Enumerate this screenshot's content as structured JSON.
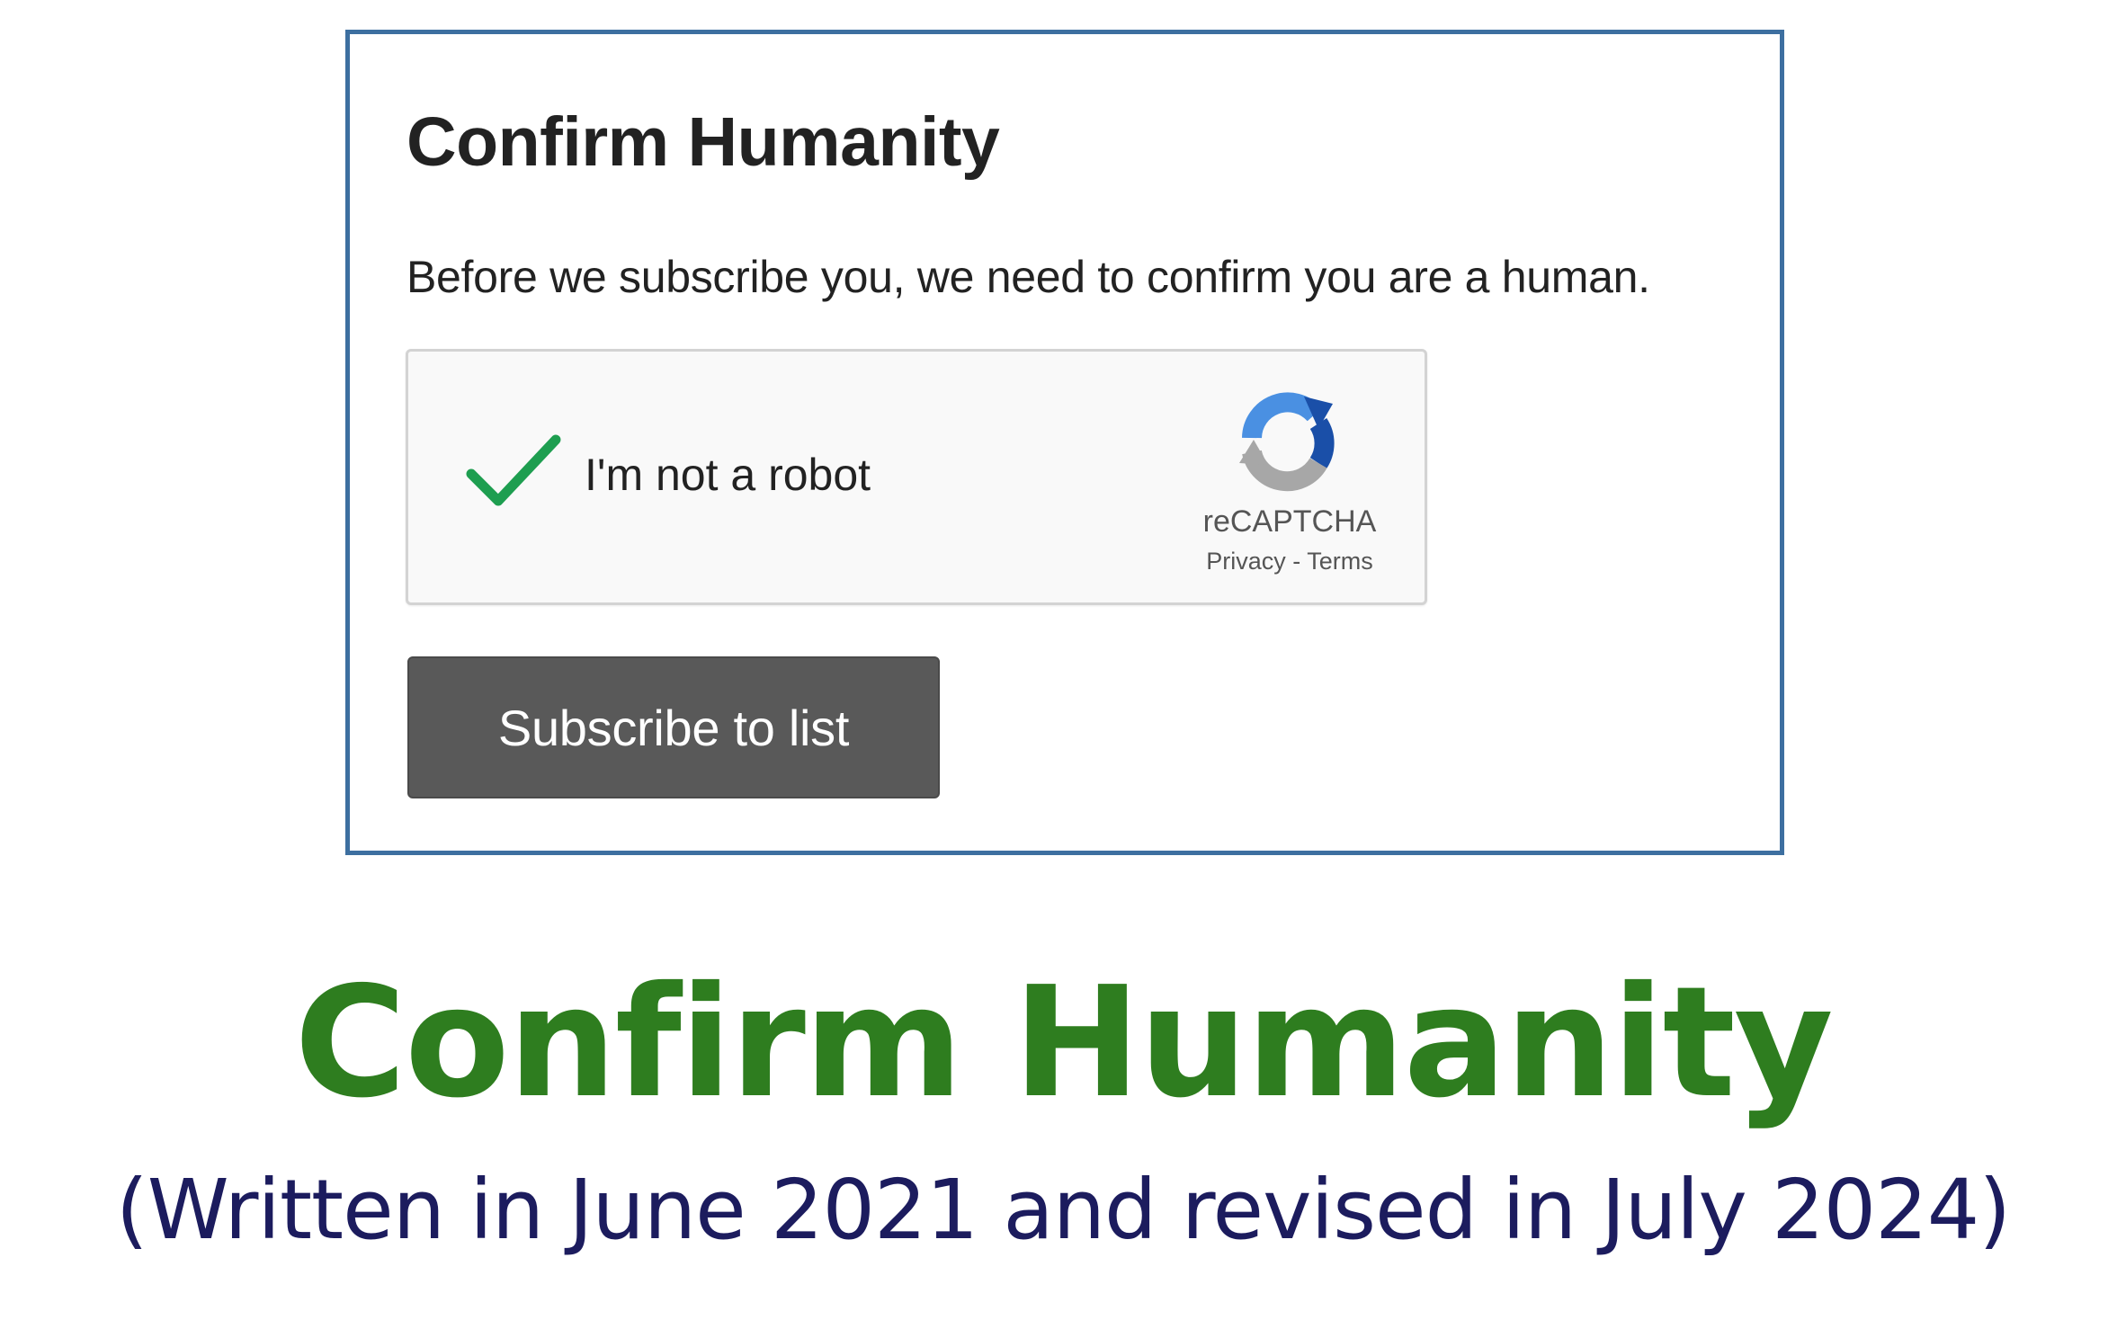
{
  "screenshot": {
    "title": "Confirm Humanity",
    "description": "Before we subscribe you, we need to confirm you are a human.",
    "captcha": {
      "checked": true,
      "label": "I'm not a robot",
      "brand": "reCAPTCHA",
      "privacy_link": "Privacy",
      "separator": " - ",
      "terms_link": "Terms"
    },
    "subscribe_button": "Subscribe to list"
  },
  "caption": {
    "title": "Confirm Humanity",
    "subtitle": "(Written in June 2021 and revised in July 2024)"
  },
  "colors": {
    "frame_border": "#3d6fa0",
    "checkmark": "#1e9e50",
    "button_bg": "#595959",
    "caption_title": "#2e7d1f",
    "caption_subtitle": "#1c1c5e"
  },
  "icons": {
    "check": "check-icon",
    "recaptcha": "recaptcha-logo-icon"
  }
}
